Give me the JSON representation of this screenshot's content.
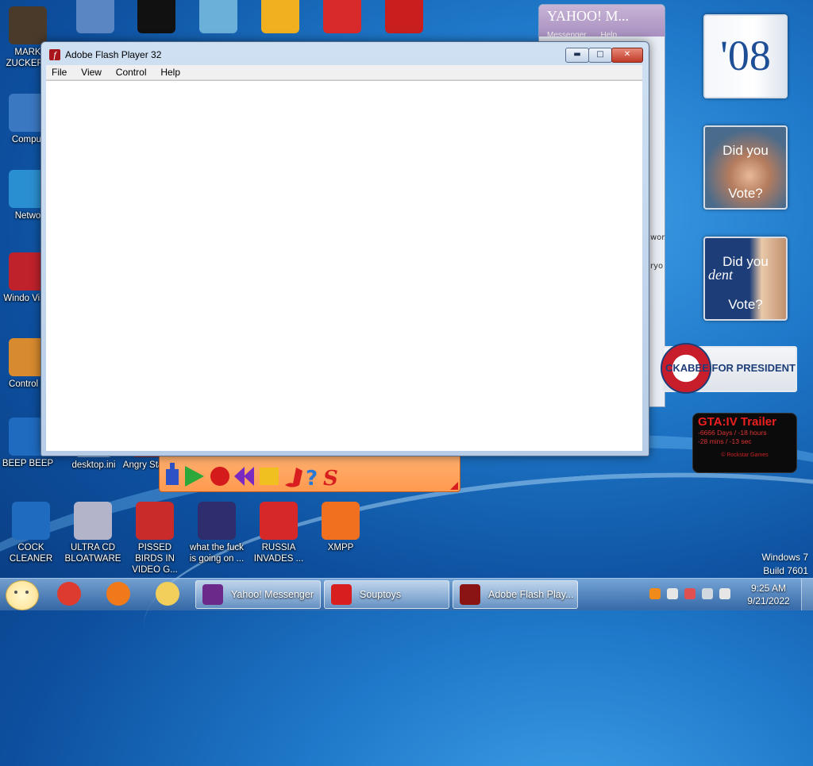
{
  "desktop": {
    "icons_left": [
      {
        "label": "MARK ZUCKERB",
        "icon": "zuckerberg-icon",
        "color": "#4a3a2a"
      },
      {
        "label": "Comput",
        "icon": "computer-icon",
        "color": "#3b78c2"
      },
      {
        "label": "Netwo",
        "icon": "network-icon",
        "color": "#2a8fd0"
      },
      {
        "label": "Windo Vista",
        "icon": "recycle-bin-icon",
        "color": "#c0222b"
      },
      {
        "label": "Control P",
        "icon": "control-panel-icon",
        "color": "#d88a2e"
      },
      {
        "label": "BEEP BEEP",
        "icon": "beep-icon",
        "color": "#1e6bc0"
      }
    ],
    "icons_top": [
      {
        "label": "",
        "icon": "document-icon",
        "color": "#5a87c4"
      },
      {
        "label": "",
        "icon": "cmd-icon",
        "color": "#111111"
      },
      {
        "label": "",
        "icon": "folder-network-icon",
        "color": "#6ab0d8"
      },
      {
        "label": "",
        "icon": "bad-piggies-icon",
        "color": "#f0b020"
      },
      {
        "label": "",
        "icon": "pidgin-icon",
        "color": "#d82a2a"
      },
      {
        "label": "",
        "icon": "dev-cpp-icon",
        "color": "#c81e1e"
      }
    ],
    "row2_icons": [
      {
        "label": "desktop.ini",
        "icon": "ini-file-icon",
        "color": "#8fb6e0"
      },
      {
        "label": "Angry Star W",
        "icon": "angry-birds-star-wars-icon",
        "color": "#8c2e2e"
      }
    ],
    "bottom_icons": [
      {
        "label": "COCK CLEANER",
        "icon": "cleaner-icon",
        "color": "#1e6bc0"
      },
      {
        "label": "ULTRA CD BLOATWARE",
        "icon": "cd-icon",
        "color": "#b3b3c9"
      },
      {
        "label": "PISSED BIRDS IN VIDEO G...",
        "icon": "angry-birds-icon",
        "color": "#c92a2a"
      },
      {
        "label": "what the fuck is going on ...",
        "icon": "angry-birds-space-icon",
        "color": "#2e2e6e"
      },
      {
        "label": "RUSSIA INVADES ...",
        "icon": "radiation-icon",
        "color": "#d62828"
      },
      {
        "label": "XMPP",
        "icon": "xampp-icon",
        "color": "#f07020"
      }
    ]
  },
  "yahoo_window": {
    "title": "YAHOO! M...",
    "menu": [
      "Messenger",
      "Help"
    ],
    "side_text": [
      "wor",
      "ryo"
    ]
  },
  "souptoys": {
    "tools": [
      "hand-tool-icon",
      "play-icon",
      "record-icon",
      "rewind-icon",
      "stop-icon",
      "music-icon",
      "help-icon",
      "souptoys-logo-icon"
    ]
  },
  "gadgets": {
    "ohEight": "'08",
    "vote1": {
      "line1": "Did you",
      "line2": "Vote?"
    },
    "vote2": {
      "line1": "Did you",
      "line2": "Vote?",
      "italic": "dent"
    },
    "huckabee": "CKABEE FOR PRESIDENT",
    "gta": {
      "title": "GTA:IV Trailer",
      "line1": "-6666 Days / -18 hours",
      "line2": "-28 mins / -13 sec",
      "footer": "© Rockstar Games"
    }
  },
  "os": {
    "line1": "Windows 7",
    "line2": "Build 7601"
  },
  "flash_window": {
    "title": "Adobe Flash Player 32",
    "menu": [
      "File",
      "View",
      "Control",
      "Help"
    ]
  },
  "taskbar": {
    "pinned": [
      {
        "icon": "chrome-icon",
        "color": "#dd3b2f"
      },
      {
        "icon": "firefox-icon",
        "color": "#f07a1a"
      },
      {
        "icon": "explorer-icon",
        "color": "#f2cf5a"
      }
    ],
    "buttons": [
      {
        "label": "Yahoo! Messenger",
        "icon": "yahoo-messenger-icon",
        "color": "#6b2a8a"
      },
      {
        "label": "Souptoys",
        "icon": "souptoys-icon",
        "color": "#d81e1e"
      },
      {
        "label": "Adobe Flash Play...",
        "icon": "flash-icon",
        "color": "#8a1414"
      }
    ],
    "tray": [
      "search-icon",
      "minus-icon",
      "flag-icon",
      "network-tray-icon",
      "volume-icon"
    ],
    "time": "9:25 AM",
    "date": "9/21/2022"
  },
  "colors": {
    "accent": "#1f78c9",
    "flash_red": "#a8161b"
  }
}
